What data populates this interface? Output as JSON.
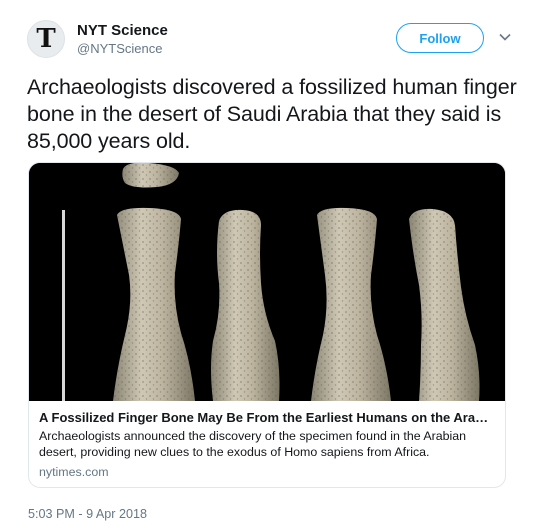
{
  "tweet": {
    "author": {
      "display_name": "NYT Science",
      "handle": "@NYTScience",
      "avatar_glyph": "T"
    },
    "follow_label": "Follow",
    "text": "Archaeologists discovered a fossilized human finger bone in the desert of Saudi Arabia that they said is 85,000 years old.",
    "card": {
      "title": "A Fossilized Finger Bone May Be From the Earliest Humans on the Arabian P...",
      "description": "Archaeologists announced the discovery of the specimen found in the Arabian desert, providing new clues to the exodus of Homo sapiens from Africa.",
      "domain": "nytimes.com"
    },
    "timestamp": "5:03 PM - 9 Apr 2018"
  },
  "colors": {
    "accent": "#1da1f2",
    "text": "#14171a",
    "muted": "#657786",
    "border": "#e1e8ed"
  },
  "icons": [
    "nyt-logo-icon",
    "chevron-down-icon"
  ]
}
